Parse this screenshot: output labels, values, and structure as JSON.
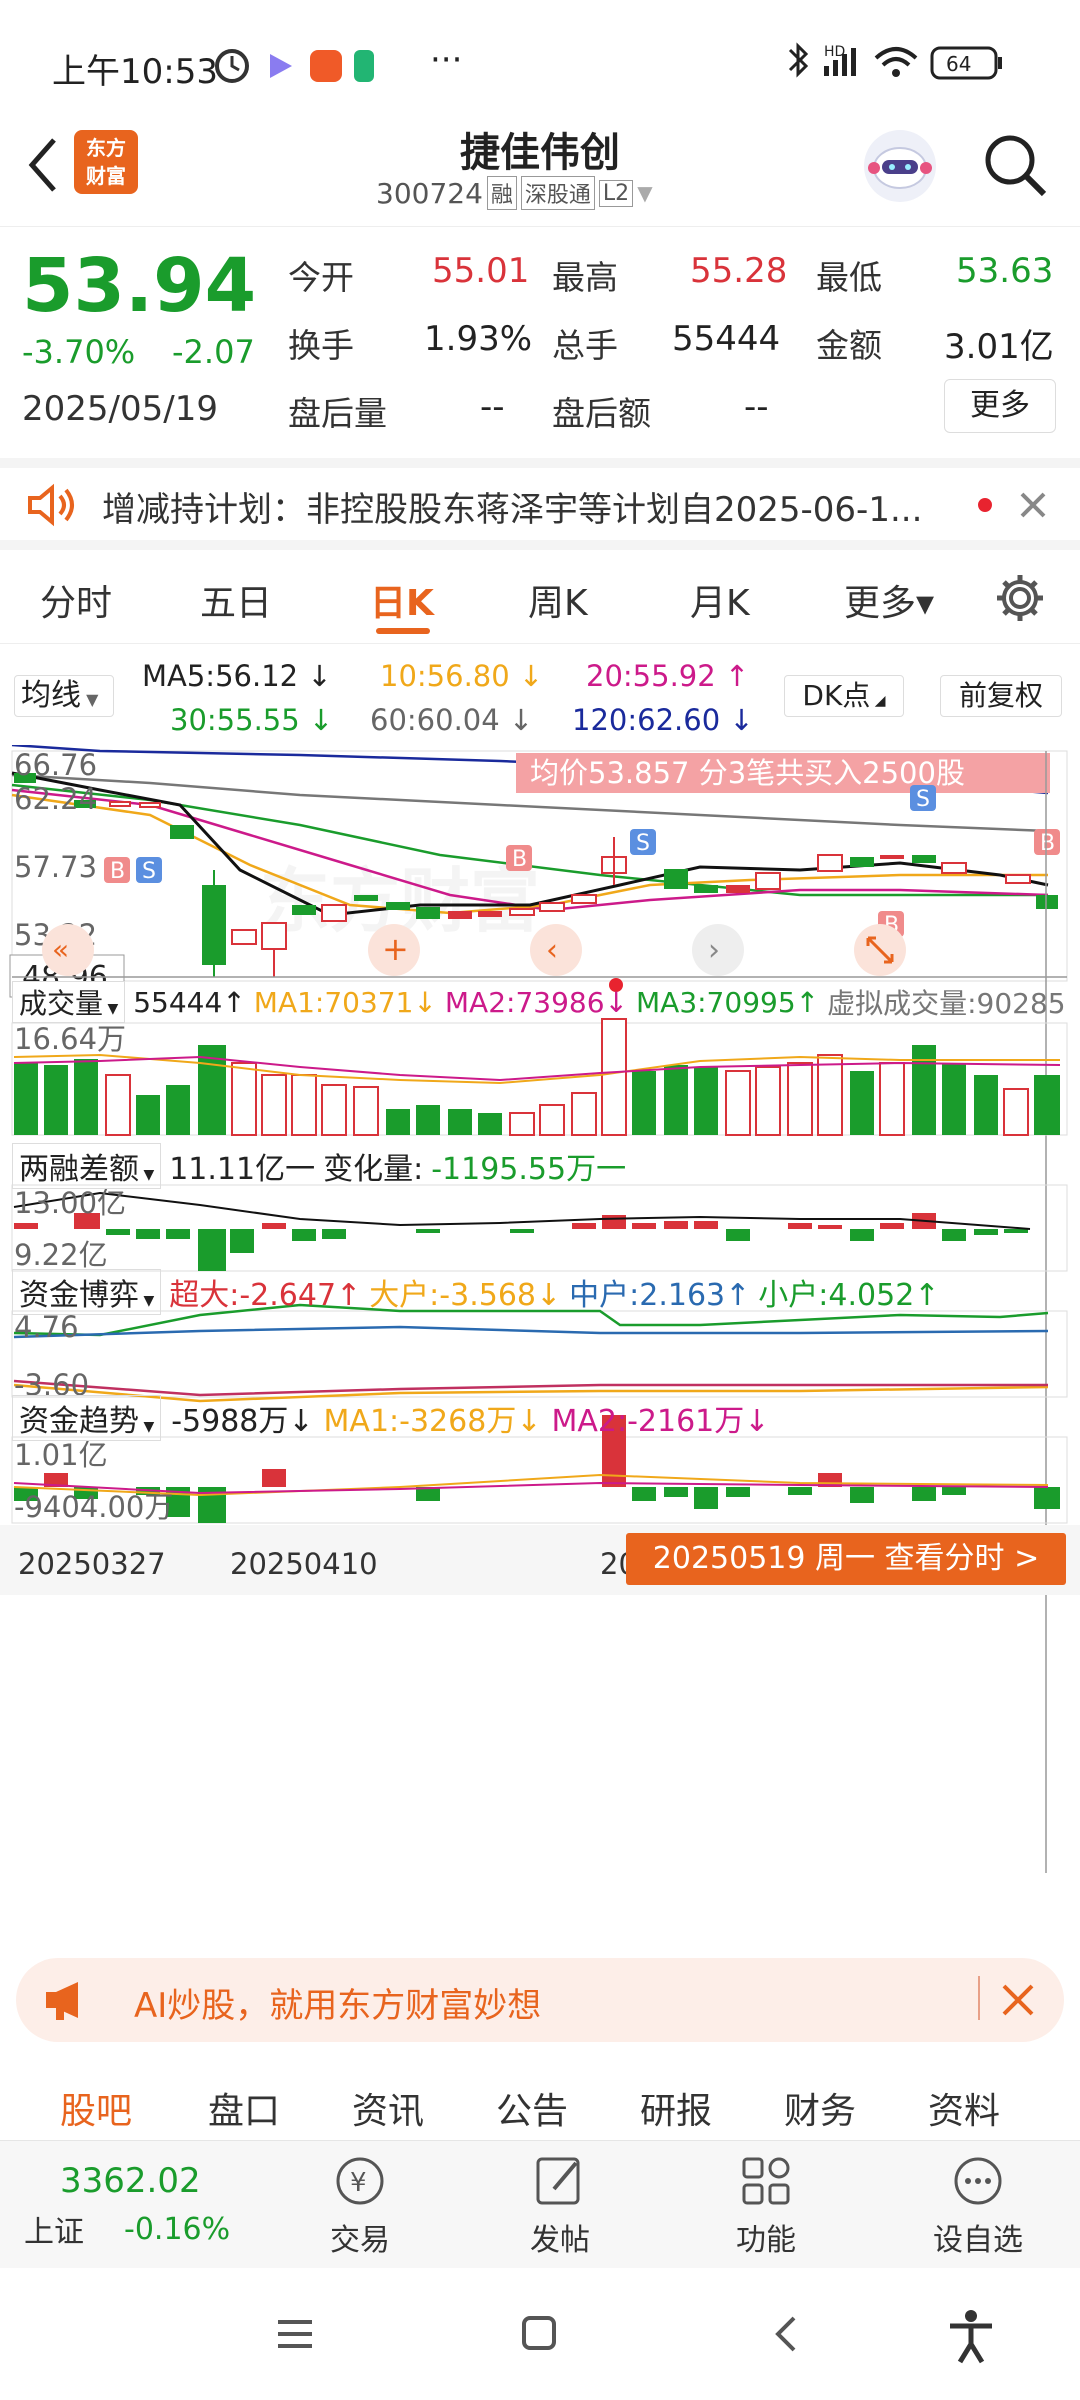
{
  "status_bar": {
    "time": "上午10:53",
    "more": "···",
    "battery": "64",
    "hd": "HD"
  },
  "header": {
    "back": "‹",
    "logo_line1": "东方",
    "logo_line2": "财富",
    "stock_name": "捷佳伟创",
    "stock_code": "300724",
    "tag_rong": "融",
    "tag_market": "深股通",
    "tag_level": "L2"
  },
  "quote": {
    "price": "53.94",
    "change_pct": "-3.70%",
    "change": "-2.07",
    "date": "2025/05/19",
    "open_label": "今开",
    "open": "55.01",
    "high_label": "最高",
    "high": "55.28",
    "low_label": "最低",
    "low": "53.63",
    "turnover_label": "换手",
    "turnover": "1.93%",
    "volume_label": "总手",
    "volume": "55444",
    "amount_label": "金额",
    "amount": "3.01亿",
    "after_vol_label": "盘后量",
    "after_vol": "--",
    "after_amt_label": "盘后额",
    "after_amt": "--",
    "more_button": "更多"
  },
  "notice": {
    "text": "增减持计划：非控股股东蒋泽宇等计划自2025-06-1..."
  },
  "period_tabs": {
    "items": [
      "分时",
      "五日",
      "日K",
      "周K",
      "月K",
      "更多▾"
    ],
    "active": "日K"
  },
  "ma_bar": {
    "select": "均线",
    "ma5": "MA5:56.12",
    "ma10": "10:56.80",
    "ma20": "20:55.92",
    "ma30": "30:55.55",
    "ma60": "60:60.04",
    "ma120": "120:62.60",
    "dk_button": "DK点",
    "fq_button": "前复权"
  },
  "kline": {
    "price_labels": [
      "66.76",
      "62.24",
      "57.73",
      "53.22",
      "48.96"
    ],
    "banner": "均价53.857  分3笔共买入2500股",
    "marker_b": "B",
    "marker_s": "S"
  },
  "volume_panel": {
    "select": "成交量",
    "vol": "55444",
    "ma1": "MA1:70371",
    "ma2": "MA2:73986",
    "ma3": "MA3:70995",
    "virtual": "虚拟成交量:90285",
    "axis_top": "16.64万"
  },
  "margin_panel": {
    "select": "两融差额",
    "value": "11.11亿一",
    "change_label": "变化量:",
    "change": "-1195.55万一",
    "axis_top": "13.00亿",
    "axis_bottom": "9.22亿"
  },
  "fund_game_panel": {
    "select": "资金博弈",
    "super": "超大:-2.647",
    "big": "大户:-3.568",
    "mid": "中户:2.163",
    "small": "小户:4.052",
    "axis_top": "4.76",
    "axis_bottom": "-3.60"
  },
  "fund_trend_panel": {
    "select": "资金趋势",
    "value": "-5988万",
    "ma1": "MA1:-3268万",
    "ma2": "MA2:-2161万",
    "axis_top": "1.01亿",
    "axis_bottom": "-9404.00万"
  },
  "date_axis": {
    "d1": "20250327",
    "d2": "20250410",
    "d3": "20",
    "tooltip": "20250519 周一 查看分时 >"
  },
  "ad": {
    "text": "AI炒股，就用东方财富妙想"
  },
  "sub_tabs": {
    "items": [
      "股吧",
      "盘口",
      "资讯",
      "公告",
      "研报",
      "财务",
      "资料"
    ],
    "active": "股吧"
  },
  "bottom": {
    "index_value": "3362.02",
    "index_name": "上证",
    "index_change": "-0.16%",
    "trade": "交易",
    "post": "发帖",
    "function": "功能",
    "watch": "设自选"
  },
  "colors": {
    "up": "#d9333a",
    "down": "#1a9c2c",
    "accent": "#e8641e"
  }
}
